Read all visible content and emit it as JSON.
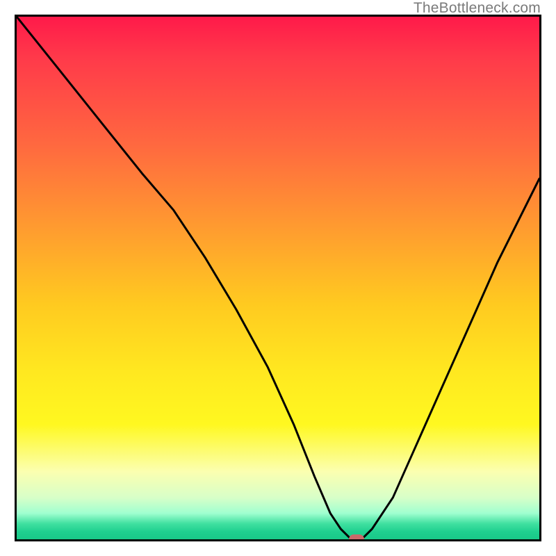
{
  "watermark": "TheBottleneck.com",
  "chart_data": {
    "type": "line",
    "title": "",
    "xlabel": "",
    "ylabel": "",
    "xlim": [
      0,
      100
    ],
    "ylim": [
      0,
      100
    ],
    "series": [
      {
        "name": "bottleneck-curve",
        "x": [
          0,
          8,
          16,
          24,
          30,
          36,
          42,
          48,
          53,
          57,
          60,
          62,
          64,
          66,
          68,
          72,
          76,
          80,
          84,
          88,
          92,
          96,
          100
        ],
        "y": [
          100,
          90,
          80,
          70,
          63,
          54,
          44,
          33,
          22,
          12,
          5,
          2,
          0,
          0,
          2,
          8,
          17,
          26,
          35,
          44,
          53,
          61,
          69
        ]
      }
    ],
    "marker": {
      "x": 65,
      "y": 0,
      "name": "optimal-point"
    },
    "background": {
      "type": "vertical-gradient",
      "stops": [
        {
          "pos": 0,
          "color": "#ff1a4a"
        },
        {
          "pos": 25,
          "color": "#ff6a3f"
        },
        {
          "pos": 55,
          "color": "#ffca20"
        },
        {
          "pos": 78,
          "color": "#fff820"
        },
        {
          "pos": 92,
          "color": "#d8ffc8"
        },
        {
          "pos": 100,
          "color": "#18c888"
        }
      ]
    }
  }
}
